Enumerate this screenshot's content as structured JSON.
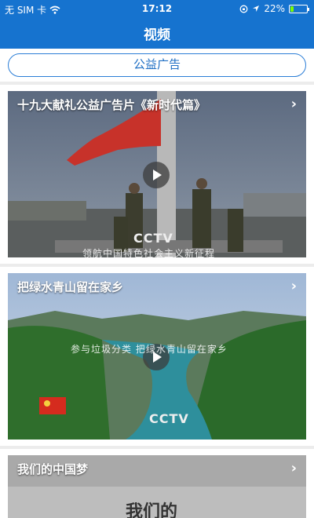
{
  "status": {
    "carrier": "无 SIM 卡",
    "time": "17:12",
    "battery": "22%",
    "battery_level": 0.22
  },
  "nav": {
    "title": "视频"
  },
  "banner": {
    "label": "公益广告"
  },
  "videos": [
    {
      "title": "十九大献礼公益广告片《新时代篇》",
      "logo": "CCTV",
      "caption": "领航中国特色社会主义新征程"
    },
    {
      "title": "把绿水青山留在家乡",
      "logo": "CCTV",
      "caption": "参与垃圾分类 把绿水青山留在家乡"
    },
    {
      "title": "我们的中国梦",
      "overlay": "我们的"
    }
  ],
  "colors": {
    "primary": "#1673cf",
    "psa_border": "#2a7dd6"
  }
}
